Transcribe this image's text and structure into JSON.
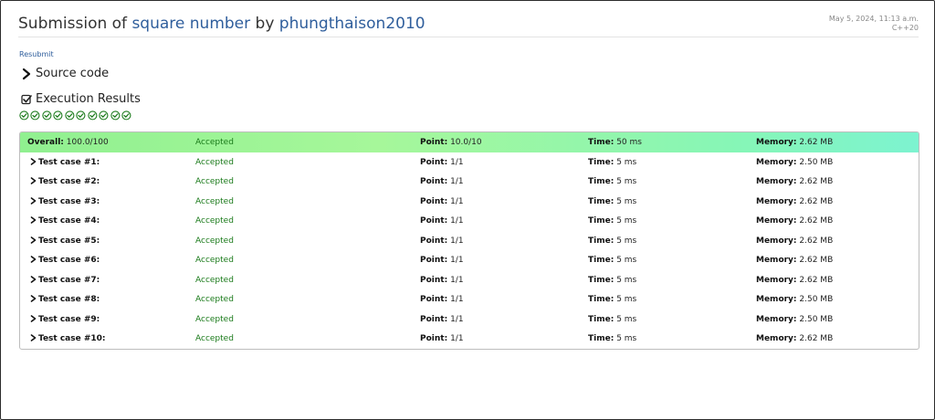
{
  "header": {
    "title_prefix": "Submission of ",
    "problem": "square number",
    "by": " by ",
    "user": "phungthaison2010",
    "date": "May 5, 2024, 11:13 a.m.",
    "language": "C++20"
  },
  "actions": {
    "resubmit": "Resubmit"
  },
  "sections": {
    "source_code": "Source code",
    "execution_results": "Execution Results"
  },
  "case_status_icons": [
    "check-circle-icon",
    "check-circle-icon",
    "check-circle-icon",
    "check-circle-icon",
    "check-circle-icon",
    "check-circle-icon",
    "check-circle-icon",
    "check-circle-icon",
    "check-circle-icon",
    "check-circle-icon"
  ],
  "colors": {
    "accepted": "#1a7a1a",
    "link": "#2f5e9c",
    "overall_start": "#90f090",
    "overall_end": "#7df3d0"
  },
  "labels": {
    "overall": "Overall:",
    "point": "Point:",
    "time": "Time:",
    "memory": "Memory:"
  },
  "overall": {
    "score": "100.0/100",
    "status": "Accepted",
    "point": "10.0/10",
    "time": "50 ms",
    "memory": "2.62 MB"
  },
  "test_cases": [
    {
      "name": "Test case #1:",
      "status": "Accepted",
      "point": "1/1",
      "time": "5 ms",
      "memory": "2.50 MB"
    },
    {
      "name": "Test case #2:",
      "status": "Accepted",
      "point": "1/1",
      "time": "5 ms",
      "memory": "2.62 MB"
    },
    {
      "name": "Test case #3:",
      "status": "Accepted",
      "point": "1/1",
      "time": "5 ms",
      "memory": "2.62 MB"
    },
    {
      "name": "Test case #4:",
      "status": "Accepted",
      "point": "1/1",
      "time": "5 ms",
      "memory": "2.62 MB"
    },
    {
      "name": "Test case #5:",
      "status": "Accepted",
      "point": "1/1",
      "time": "5 ms",
      "memory": "2.62 MB"
    },
    {
      "name": "Test case #6:",
      "status": "Accepted",
      "point": "1/1",
      "time": "5 ms",
      "memory": "2.62 MB"
    },
    {
      "name": "Test case #7:",
      "status": "Accepted",
      "point": "1/1",
      "time": "5 ms",
      "memory": "2.62 MB"
    },
    {
      "name": "Test case #8:",
      "status": "Accepted",
      "point": "1/1",
      "time": "5 ms",
      "memory": "2.50 MB"
    },
    {
      "name": "Test case #9:",
      "status": "Accepted",
      "point": "1/1",
      "time": "5 ms",
      "memory": "2.50 MB"
    },
    {
      "name": "Test case #10:",
      "status": "Accepted",
      "point": "1/1",
      "time": "5 ms",
      "memory": "2.62 MB"
    }
  ]
}
